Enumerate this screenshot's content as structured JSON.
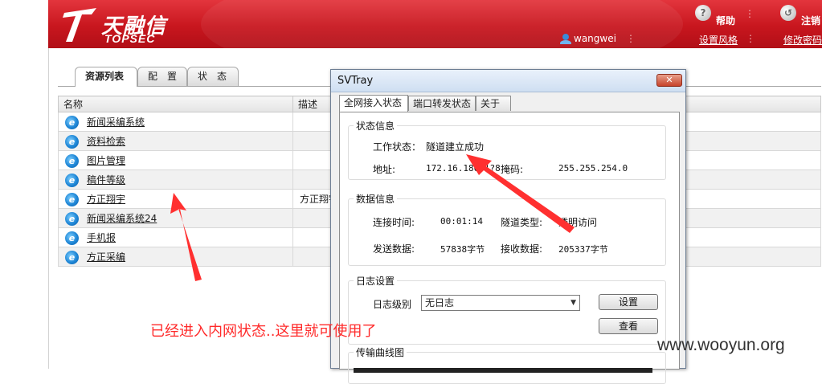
{
  "header": {
    "logo_cn": "天融信",
    "logo_en": "TOPSEC",
    "help_label": "帮助",
    "logout_label": "注销",
    "username": "wangwei",
    "style_link": "设置风格",
    "password_link": "修改密码",
    "help_icon_glyph": "?",
    "logout_icon_glyph": "↺"
  },
  "main": {
    "tabs": [
      {
        "label": "资源列表",
        "active": true
      },
      {
        "label": "配　置",
        "active": false
      },
      {
        "label": "状　态",
        "active": false
      }
    ],
    "table": {
      "columns": [
        "名称",
        "描述"
      ],
      "rows": [
        {
          "name": "新闻采编系统",
          "desc": ""
        },
        {
          "name": "资料检索",
          "desc": ""
        },
        {
          "name": "图片管理",
          "desc": ""
        },
        {
          "name": "稿件等级",
          "desc": ""
        },
        {
          "name": "方正翔宇",
          "desc": "方正翔宇"
        },
        {
          "name": "新闻采编系统24",
          "desc": ""
        },
        {
          "name": "手机报",
          "desc": ""
        },
        {
          "name": "方正采编",
          "desc": ""
        }
      ]
    }
  },
  "dialog": {
    "title": "SVTray",
    "close_glyph": "✕",
    "tabs": [
      {
        "label": "全网接入状态",
        "active": true
      },
      {
        "label": "端口转发状态",
        "active": false
      },
      {
        "label": "关于",
        "active": false
      }
    ],
    "status": {
      "group_title": "状态信息",
      "work_state_label": "工作状态：",
      "work_state_value": "隧道建立成功",
      "address_label": "地址:",
      "address_value": "172.16.180.1?8",
      "mask_label": "掩码:",
      "mask_value": "255.255.254.0"
    },
    "data": {
      "group_title": "数据信息",
      "conn_time_label": "连接时间:",
      "conn_time_value": "00:01:14",
      "tunnel_type_label": "隧道类型:",
      "tunnel_type_value": "透明访问",
      "sent_label": "发送数据:",
      "sent_value": "57838字节",
      "recv_label": "接收数据:",
      "recv_value": "205337字节"
    },
    "log": {
      "group_title": "日志设置",
      "level_label": "日志级别",
      "level_value": "无日志",
      "set_button": "设置",
      "view_button": "查看"
    },
    "chart": {
      "group_title": "传输曲线图"
    }
  },
  "annotation": {
    "text": "已经进入内网状态..这里就可使用了",
    "color": "#ff2a2a"
  },
  "watermark": "www.wooyun.org",
  "colors": {
    "header_red": "#c8161e",
    "ie_blue": "#1e86d6"
  }
}
